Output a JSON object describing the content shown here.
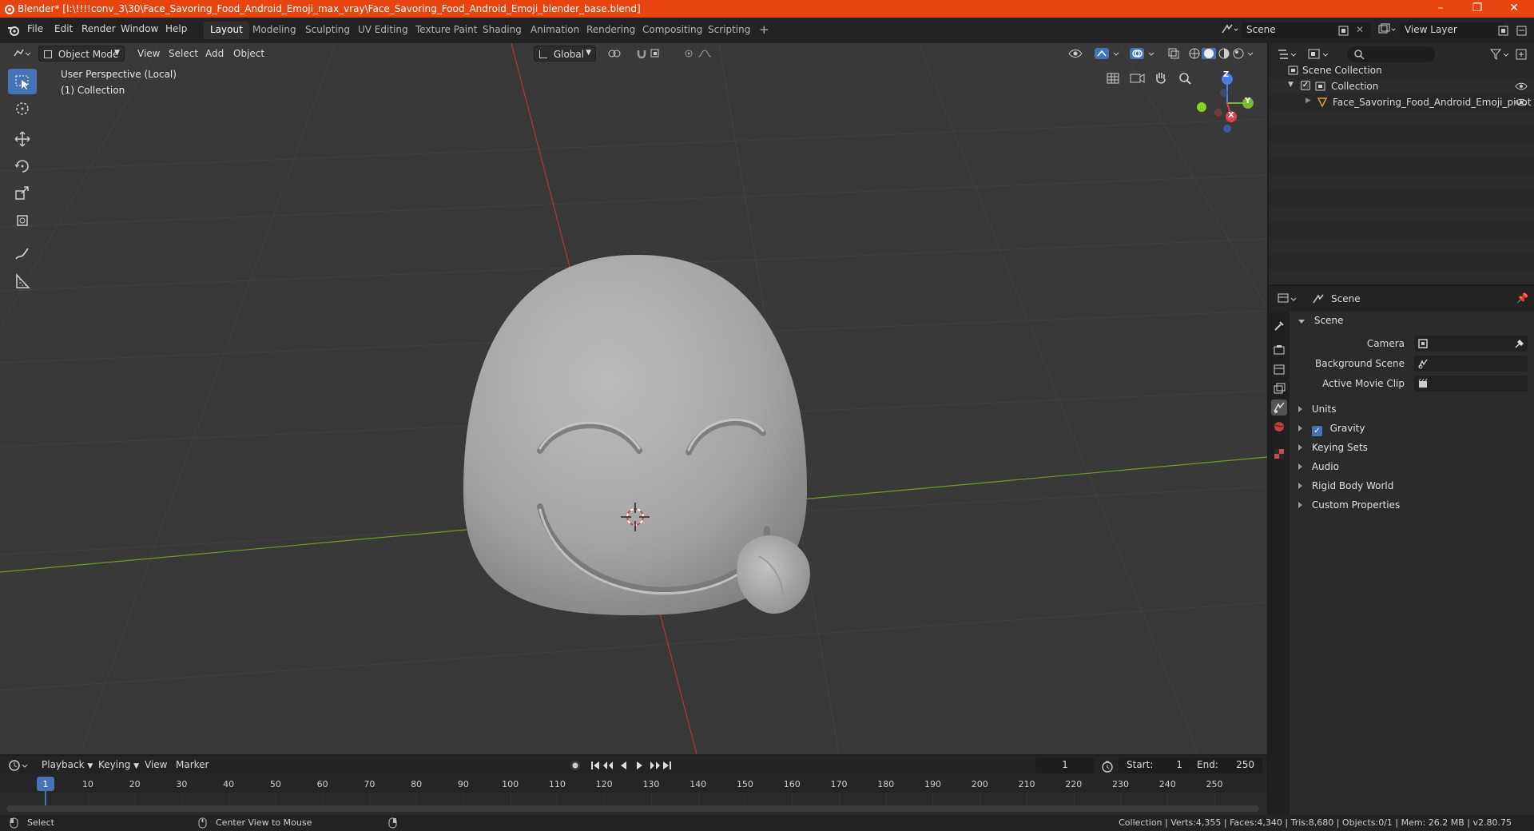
{
  "titlebar": {
    "title": "Blender* [I:\\!!!!conv_3\\30\\Face_Savoring_Food_Android_Emoji_max_vray\\Face_Savoring_Food_Android_Emoji_blender_base.blend]",
    "minimize_icon": "minimize-icon",
    "maximize_icon": "restore-icon",
    "close_icon": "close-icon"
  },
  "menu": {
    "items": [
      "File",
      "Edit",
      "Render",
      "Window",
      "Help"
    ]
  },
  "workspaces": {
    "tabs": [
      "Layout",
      "Modeling",
      "Sculpting",
      "UV Editing",
      "Texture Paint",
      "Shading",
      "Animation",
      "Rendering",
      "Compositing",
      "Scripting"
    ],
    "active": "Layout",
    "add_label": "+"
  },
  "scene_selector": {
    "value": "Scene"
  },
  "view_layer_selector": {
    "value": "View Layer"
  },
  "viewport_header": {
    "mode": "Object Mode",
    "menus": [
      "View",
      "Select",
      "Add",
      "Object"
    ],
    "orientation": "Global"
  },
  "viewport": {
    "perspective_label": "User Perspective (Local)",
    "collection_label": "(1) Collection",
    "gizmo_axes": {
      "z": "Z",
      "y": "Y",
      "x": "X"
    },
    "colors": {
      "background": "#393939",
      "grid": "#444444",
      "x_axis": "#b33a3a",
      "y_axis": "#6b9a2c",
      "model": "#a9a9a9"
    }
  },
  "outliner": {
    "search_placeholder": "",
    "rows": [
      {
        "label": "Scene Collection",
        "icon": "scene-collection-icon"
      },
      {
        "label": "Collection",
        "icon": "collection-icon"
      },
      {
        "label": "Face_Savoring_Food_Android_Emoji_pivot",
        "icon": "mesh-object-icon"
      }
    ]
  },
  "properties": {
    "context_label": "Scene",
    "panel_title": "Scene",
    "fields": [
      {
        "label": "Camera",
        "value": ""
      },
      {
        "label": "Background Scene",
        "value": ""
      },
      {
        "label": "Active Movie Clip",
        "value": ""
      }
    ],
    "sections": [
      {
        "label": "Units"
      },
      {
        "label": "Gravity",
        "checked": true
      },
      {
        "label": "Keying Sets"
      },
      {
        "label": "Audio"
      },
      {
        "label": "Rigid Body World"
      },
      {
        "label": "Custom Properties"
      }
    ]
  },
  "timeline": {
    "menus": [
      "Playback",
      "Keying",
      "View",
      "Marker"
    ],
    "current_frame": "1",
    "start_label": "Start:",
    "start_value": "1",
    "end_label": "End:",
    "end_value": "250",
    "ruler_ticks": [
      "1",
      "10",
      "20",
      "30",
      "40",
      "50",
      "60",
      "70",
      "80",
      "90",
      "100",
      "110",
      "120",
      "130",
      "140",
      "150",
      "160",
      "170",
      "180",
      "190",
      "200",
      "210",
      "220",
      "230",
      "240",
      "250"
    ]
  },
  "statusbar": {
    "left_action": "Select",
    "middle_action": "Center View to Mouse",
    "stats": "Collection | Verts:4,355 | Faces:4,340 | Tris:8,680 | Objects:0/1 | Mem: 26.2 MB | v2.80.75"
  }
}
